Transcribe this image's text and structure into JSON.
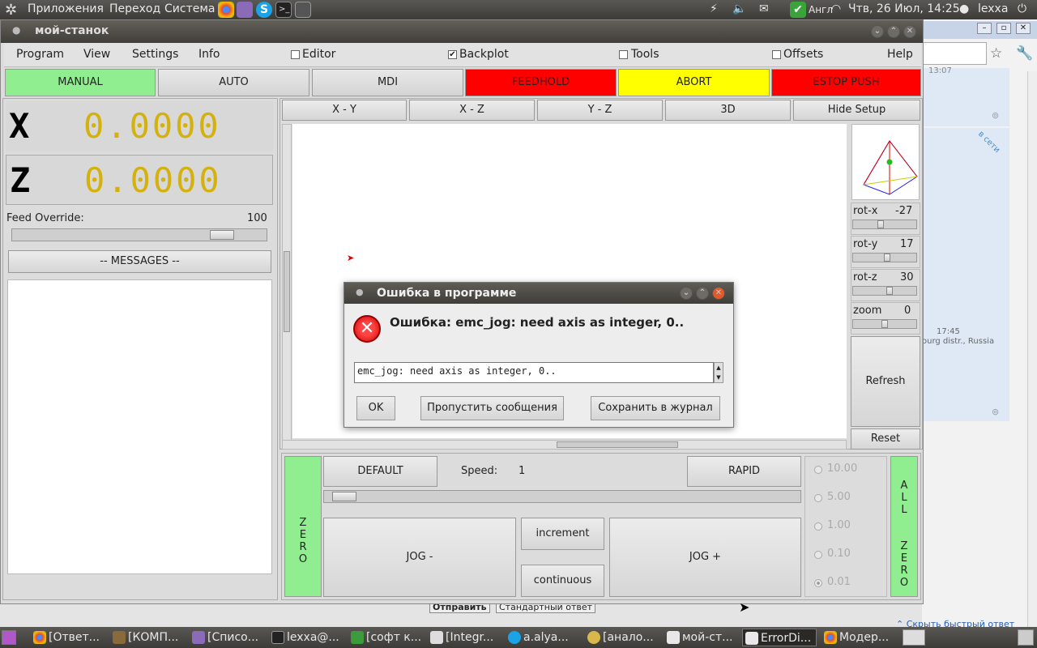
{
  "top_panel": {
    "menu": [
      "Приложения",
      "Переход",
      "Система"
    ],
    "keyboard_layout": "Англ",
    "datetime": "Чтв, 26 Июл, 14:25",
    "user": "lexxa"
  },
  "window": {
    "title": "мой-станок",
    "menu": {
      "program": "Program",
      "view": "View",
      "settings": "Settings",
      "info": "Info"
    },
    "checks": {
      "editor": {
        "label": "Editor",
        "checked": false,
        "mark": ""
      },
      "backplot": {
        "label": "Backplot",
        "checked": true,
        "mark": "✔"
      },
      "tools": {
        "label": "Tools",
        "checked": false,
        "mark": ""
      },
      "offsets": {
        "label": "Offsets",
        "checked": false,
        "mark": ""
      }
    },
    "help": "Help",
    "modes": {
      "manual": "MANUAL",
      "auto": "AUTO",
      "mdi": "MDI",
      "feedhold": "FEEDHOLD",
      "abort": "ABORT",
      "estop": "ESTOP PUSH"
    },
    "colors": {
      "manual": "#90ee90",
      "feedhold": "#ff0000",
      "abort": "#ffff00",
      "estop": "#ff0000",
      "dro_value": "#d4b10c",
      "zero_green": "#90ee90"
    }
  },
  "dro": {
    "x": {
      "axis": "X",
      "value": "0.0000"
    },
    "z": {
      "axis": "Z",
      "value": "0.0000"
    }
  },
  "feed_override": {
    "label": "Feed Override:",
    "value": "100",
    "fraction": 0.86
  },
  "messages_button": "-- MESSAGES --",
  "view_tabs": {
    "xy": "X - Y",
    "xz": "X - Z",
    "yz": "Y - Z",
    "three_d": "3D",
    "hide_setup": "Hide Setup"
  },
  "view_controls": {
    "rot_x": {
      "label": "rot-x",
      "value": "-27"
    },
    "rot_y": {
      "label": "rot-y",
      "value": "17"
    },
    "rot_z": {
      "label": "rot-z",
      "value": "30"
    },
    "zoom": {
      "label": "zoom",
      "value": "0"
    },
    "refresh": "Refresh",
    "reset": "Reset"
  },
  "jog": {
    "zero_letters": "Z E R O",
    "all_zero_letters": "A L L   Z E R O",
    "default": "DEFAULT",
    "speed_label": "Speed:",
    "speed_value": "1",
    "rapid": "RAPID",
    "jog_minus": "JOG  -",
    "jog_plus": "JOG  +",
    "increment": "increment",
    "continuous": "continuous",
    "increments": [
      "10.00",
      "5.00",
      "1.00",
      "0.10",
      "0.01"
    ],
    "selected_increment": "0.01"
  },
  "dialog": {
    "title": "Ошибка в программе",
    "message": "Ошибка: emc_jog: need axis as integer, 0..",
    "detail": "emc_jog: need axis as integer, 0..",
    "ok": "OK",
    "skip": "Пропустить сообщения",
    "save": "Сохранить в журнал"
  },
  "browser_bg": {
    "time1": "13:07",
    "badge": "в сети",
    "time2": "17:45",
    "location": "ourg distr., Russia",
    "send": "Отправить",
    "standard_reply": "Стандартный ответ",
    "hide_reply": "Скрыть быстрый ответ"
  },
  "taskbar": [
    "[Ответ...",
    "[КОМП...",
    "[Списо...",
    "lexxa@...",
    "[софт к...",
    "[Integr...",
    "a.alya...",
    "[анало...",
    "мой-ст...",
    "ErrorDi...",
    "Модер..."
  ]
}
